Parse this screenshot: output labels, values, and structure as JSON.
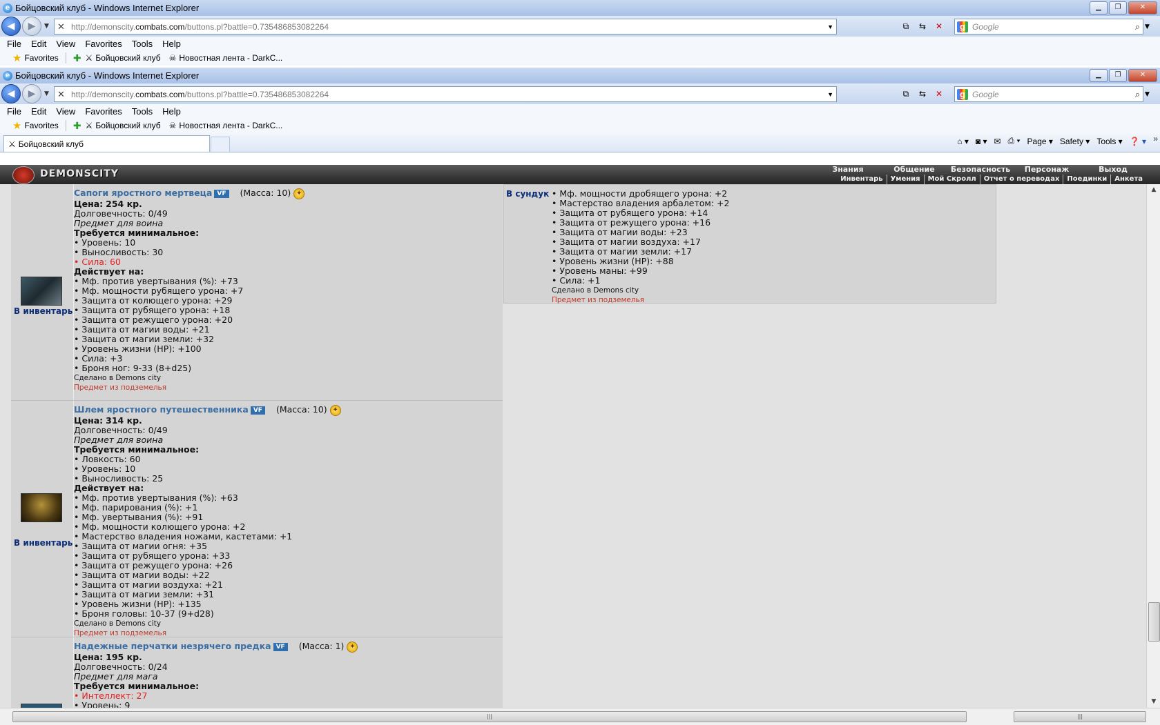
{
  "browser": {
    "window_title": "Бойцовский клуб - Windows Internet Explorer",
    "url": {
      "prefix": "http://demonscity.",
      "domain": "combats.com",
      "path": "/buttons.pl?battle=0.735486853082264"
    },
    "search_placeholder": "Google",
    "menu": [
      "File",
      "Edit",
      "View",
      "Favorites",
      "Tools",
      "Help"
    ],
    "favorites_label": "Favorites",
    "fav_links": [
      "Бойцовский клуб",
      "Новостная лента - DarkC..."
    ],
    "tab_title": "Бойцовский клуб",
    "cmd": {
      "page": "Page",
      "safety": "Safety",
      "tools": "Tools"
    }
  },
  "site": {
    "name": "DEMONSCITY",
    "nav_top": [
      "Знания",
      "Общение",
      "Безопасность",
      "Персонаж",
      "Выход"
    ],
    "nav_bottom": [
      "Инвентарь",
      "Умения",
      "Мой Скролл",
      "Отчет о переводах",
      "Поединки",
      "Анкета"
    ]
  },
  "action_to_inventory": "В инвентарь",
  "action_to_chest": "В сундук",
  "items": [
    {
      "name": "Сапоги яростного мертвеца",
      "vf": "VF",
      "mass": "(Масса: 10)",
      "price_label": "Цена:",
      "price_value": "254 кр.",
      "durability": "Долговечность: 0/49",
      "type": "Предмет для воина",
      "req_title": "Требуется минимальное:",
      "requirements": [
        "• Уровень: 10",
        "• Выносливость: 30"
      ],
      "requirements_red": [
        "• Сила: 60"
      ],
      "effects_title": "Действует на:",
      "effects": [
        "• Мф. против увертывания (%): +73",
        "• Мф. мощности рубящего урона: +7",
        "• Защита от колющего урона: +29",
        "• Защита от рубящего урона: +18",
        "• Защита от режущего урона: +20",
        "• Защита от магии воды: +21",
        "• Защита от магии земли: +32",
        "• Уровень жизни (HP): +100",
        "• Сила: +3",
        "• Броня ног: 9-33 (8+d25)"
      ],
      "made_in": "Сделано в Demons city",
      "source": "Предмет из подземелья"
    },
    {
      "name": "Шлем яростного путешественника",
      "vf": "VF",
      "mass": "(Масса: 10)",
      "price_label": "Цена:",
      "price_value": "314 кр.",
      "durability": "Долговечность: 0/49",
      "type": "Предмет для воина",
      "req_title": "Требуется минимальное:",
      "requirements": [
        "• Ловкость: 60",
        "• Уровень: 10",
        "• Выносливость: 25"
      ],
      "requirements_red": [],
      "effects_title": "Действует на:",
      "effects": [
        "• Мф. против увертывания (%): +63",
        "• Мф. парирования (%): +1",
        "• Мф. увертывания (%): +91",
        "• Мф. мощности колющего урона: +2",
        "• Мастерство владения ножами, кастетами: +1",
        "• Защита от магии огня: +35",
        "• Защита от рубящего урона: +33",
        "• Защита от режущего урона: +26",
        "• Защита от магии воды: +22",
        "• Защита от магии воздуха: +21",
        "• Защита от магии земли: +31",
        "• Уровень жизни (HP): +135",
        "• Броня головы: 10-37 (9+d28)"
      ],
      "made_in": "Сделано в Demons city",
      "source": "Предмет из подземелья"
    },
    {
      "name": "Надежные перчатки незрячего предка",
      "vf": "VF",
      "mass": "(Масса: 1)",
      "price_label": "Цена:",
      "price_value": "195 кр.",
      "durability": "Долговечность: 0/24",
      "type": "Предмет для мага",
      "req_title": "Требуется минимальное:",
      "requirements_red": [
        "• Интеллект: 27"
      ],
      "requirements": [
        "• Уровень: 9"
      ]
    }
  ],
  "chest_item": {
    "effects": [
      "• Мф. мощности дробящего урона: +2",
      "• Мастерство владения арбалетом: +2",
      "• Защита от рубящего урона: +14",
      "• Защита от режущего урона: +16",
      "• Защита от магии воды: +23",
      "• Защита от магии воздуха: +17",
      "• Защита от магии земли: +17",
      "• Уровень жизни (HP): +88",
      "• Уровень маны: +99",
      "• Сила: +1"
    ],
    "made_in": "Сделано в Demons city",
    "source": "Предмет из подземелья"
  }
}
